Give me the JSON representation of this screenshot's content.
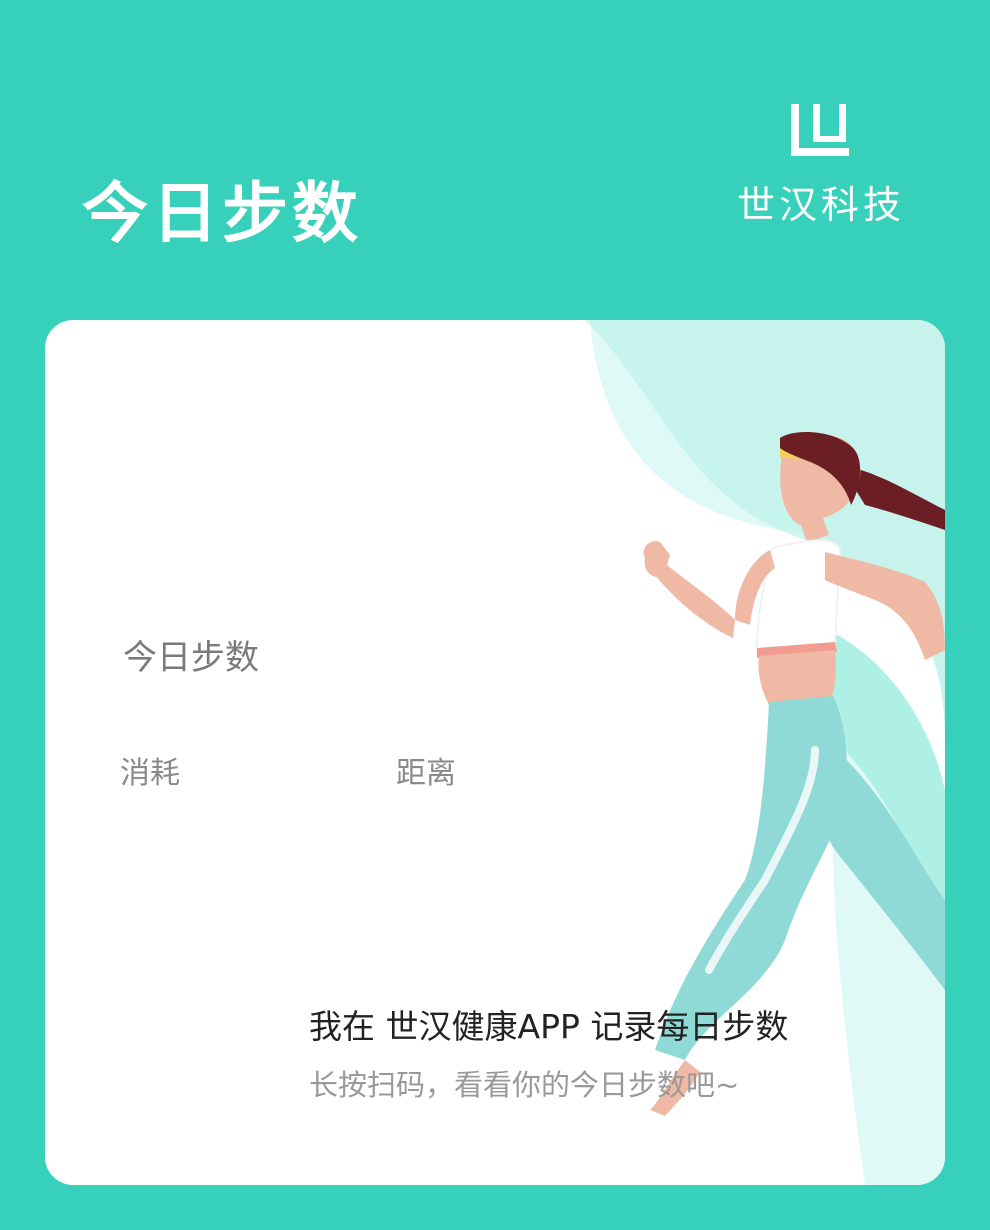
{
  "header": {
    "title": "今日步数"
  },
  "brand": {
    "logo_mark": "LU",
    "name": "世汉科技"
  },
  "card": {
    "steps_label": "今日步数",
    "calories_label": "消耗",
    "distance_label": "距离",
    "share_title": "我在 世汉健康APP 记录每日步数",
    "share_subtitle": "长按扫码，看看你的今日步数吧~"
  },
  "colors": {
    "background": "#37d1bb",
    "card": "#ffffff",
    "accent_light": "#aef0e6"
  },
  "icons": {
    "illustration": "running-woman-illustration"
  }
}
